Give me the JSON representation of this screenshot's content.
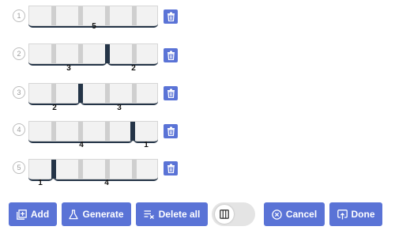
{
  "rows": [
    {
      "number": "1",
      "active_separator": null,
      "groups": [
        "5"
      ]
    },
    {
      "number": "2",
      "active_separator": 3,
      "groups": [
        "3",
        "2"
      ]
    },
    {
      "number": "3",
      "active_separator": 2,
      "groups": [
        "2",
        "3"
      ]
    },
    {
      "number": "4",
      "active_separator": 4,
      "groups": [
        "4",
        "1"
      ]
    },
    {
      "number": "5",
      "active_separator": 1,
      "groups": [
        "1",
        "4"
      ]
    }
  ],
  "toolbar": {
    "add_label": "Add",
    "generate_label": "Generate",
    "delete_all_label": "Delete all",
    "cancel_label": "Cancel",
    "done_label": "Done"
  },
  "icons": {
    "row_delete": "trash-icon",
    "add": "add-box-icon",
    "generate": "flask-icon",
    "delete_all": "clear-list-icon",
    "toggle": "columns-icon",
    "cancel": "circle-x-icon",
    "done": "upload-icon"
  },
  "colors": {
    "accent": "#5a73d6",
    "active_separator": "#243447",
    "cell": "#f2f2f2",
    "separator": "#cfcfcf"
  }
}
